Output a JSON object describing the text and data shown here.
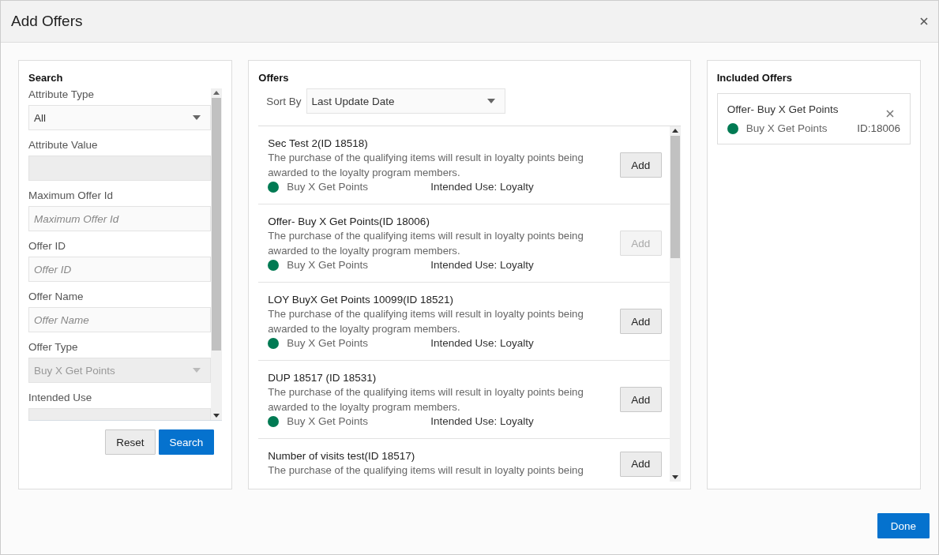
{
  "window": {
    "title": "Add Offers"
  },
  "search": {
    "title": "Search",
    "fields": [
      {
        "label": "Attribute Type",
        "kind": "select",
        "value": "All",
        "disabled": false
      },
      {
        "label": "Attribute Value",
        "kind": "input",
        "disabled": true
      },
      {
        "label": "Maximum Offer Id",
        "kind": "input",
        "placeholder": "Maximum Offer Id",
        "disabled": false
      },
      {
        "label": "Offer ID",
        "kind": "input",
        "placeholder": "Offer ID",
        "disabled": false
      },
      {
        "label": "Offer Name",
        "kind": "input",
        "placeholder": "Offer Name",
        "disabled": false
      },
      {
        "label": "Offer Type",
        "kind": "select",
        "value": "Buy X Get Points",
        "disabled": true
      },
      {
        "label": "Intended Use",
        "kind": "input",
        "disabled": true
      }
    ],
    "buttons": [
      {
        "label": "Reset",
        "kind": "secondary"
      },
      {
        "label": "Search",
        "kind": "primary"
      }
    ]
  },
  "offers": {
    "title": "Offers",
    "sort_label": "Sort By",
    "sort_value": "Last Update Date",
    "items": [
      {
        "title": "Sec Test 2(ID 18518)",
        "description": "The purchase of the qualifying items will result in loyalty points being awarded to the loyalty program members.",
        "type": "Buy X Get Points",
        "color": "#007a53",
        "use": "Intended Use: Loyalty",
        "button": "Add",
        "disabled": false
      },
      {
        "title": "Offer- Buy X Get Points(ID 18006)",
        "description": "The purchase of the qualifying items will result in loyalty points being awarded to the loyalty program members.",
        "type": "Buy X Get Points",
        "color": "#007a53",
        "use": "Intended Use: Loyalty",
        "button": "Add",
        "disabled": true
      },
      {
        "title": "LOY BuyX Get Points 10099(ID 18521)",
        "description": "The purchase of the qualifying items will result in loyalty points being awarded to the loyalty program members.",
        "type": "Buy X Get Points",
        "color": "#007a53",
        "use": "Intended Use: Loyalty",
        "button": "Add",
        "disabled": false
      },
      {
        "title": "DUP 18517 (ID 18531)",
        "description": "The purchase of the qualifying items will result in loyalty points being awarded to the loyalty program members.",
        "type": "Buy X Get Points",
        "color": "#007a53",
        "use": "Intended Use: Loyalty",
        "button": "Add",
        "disabled": false
      },
      {
        "title": "Number of visits test(ID 18517)",
        "description": "The purchase of the qualifying items will result in loyalty points being",
        "button": "Add",
        "disabled": false
      }
    ]
  },
  "included": {
    "title": "Included Offers",
    "items": [
      {
        "title": "Offer- Buy X Get Points",
        "type": "Buy X Get Points",
        "color": "#007a53",
        "id": "ID:18006"
      }
    ]
  },
  "done_button": "Done"
}
